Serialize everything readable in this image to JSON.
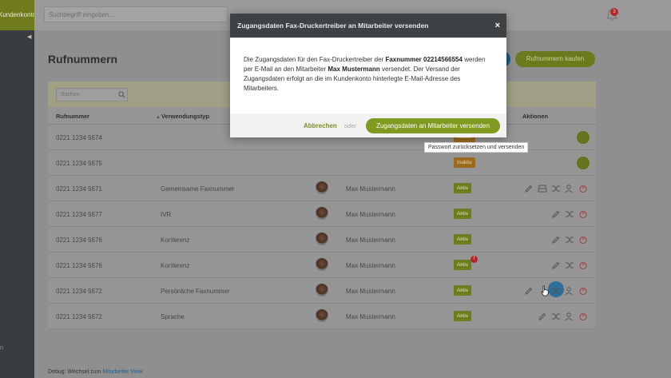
{
  "sidebar": {
    "brand": "Kundenkonto",
    "collapse_icon": "chevron-left-icon",
    "bottom_text": "n"
  },
  "topbar": {
    "search_placeholder": "Suchbegriff eingeben...",
    "notifications_count": "3"
  },
  "page": {
    "title": "Rufnummern",
    "buy_button": "Rufnummern kaufen",
    "filter_placeholder": "Suchen",
    "columns": {
      "number": "Rufnummer",
      "type": "Verwendungstyp",
      "actions": "Aktionen"
    }
  },
  "rows": [
    {
      "number": "0221 1234 5674",
      "type": "",
      "user": "",
      "status": "Inaktiv",
      "status_kind": "inactive"
    },
    {
      "number": "0221 1234 5675",
      "type": "",
      "user": "",
      "status": "Inaktiv",
      "status_kind": "inactive"
    },
    {
      "number": "0221 1234 5671",
      "type": "Gemeinsame Faxnummer",
      "user": "Max Mustermann",
      "status": "Aktiv",
      "status_kind": "active"
    },
    {
      "number": "0221 1234 5677",
      "type": "IVR",
      "user": "Max Mustermann",
      "status": "Aktiv",
      "status_kind": "active"
    },
    {
      "number": "0221 1234 5676",
      "type": "Konferenz",
      "user": "Max Mustermann",
      "status": "Aktiv",
      "status_kind": "active"
    },
    {
      "number": "0221 1234 5676",
      "type": "Konferenz",
      "user": "Max Mustermann",
      "status": "Aktiv",
      "status_kind": "active",
      "alert": "!"
    },
    {
      "number": "0221 1234 5672",
      "type": "Persönliche Faxnummer",
      "user": "Max Mustermann",
      "status": "Aktiv",
      "status_kind": "active"
    },
    {
      "number": "0221 1234 5672",
      "type": "Sprache",
      "user": "Max Mustermann",
      "status": "Aktiv",
      "status_kind": "active"
    }
  ],
  "debug": {
    "prefix": "Debug: Wechsel zum",
    "link": "Mitarbeiter View"
  },
  "modal": {
    "title": "Zugangsdaten Fax-Druckertreiber an Mitarbeiter versenden",
    "close": "×",
    "text_1": "Die Zugangsdaten für den Fax-Druckertreiber der",
    "fax_label": "Faxnummer 02214566554",
    "text_2": "werden per E-Mail an den Mitarbeiter",
    "employee": "Max Mustermann",
    "text_3": "versendet. Der Versand der Zugangsdaten erfolgt an die im Kundenkonto hinterlegte E-Mail-Adresse des Mitarbeiters.",
    "cancel": "Abbrechen",
    "or": "oder",
    "confirm": "Zugangsdaten an Mitarbeiter versenden"
  },
  "tooltip": "Passwort zurücksetzen und versenden",
  "colors": {
    "accent": "#7f9a21",
    "header": "#3f4244",
    "alert": "#b02a2a",
    "inactive": "#9a6a1e"
  }
}
